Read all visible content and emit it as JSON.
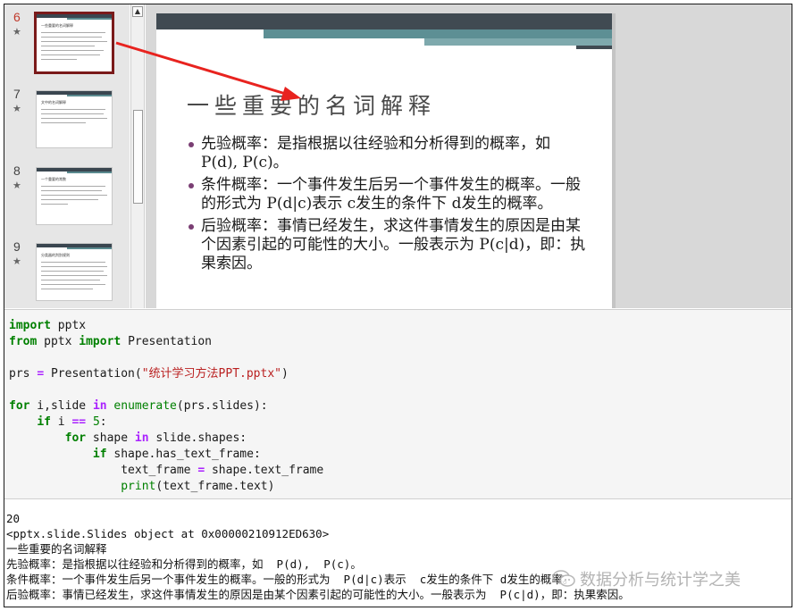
{
  "thumbnails": [
    {
      "number": "6",
      "star": "★",
      "title": "一些重要的名词解释",
      "active": true
    },
    {
      "number": "7",
      "star": "★",
      "title": "文中的名词解释",
      "active": false
    },
    {
      "number": "8",
      "star": "★",
      "title": "一个重要的常数",
      "active": false
    },
    {
      "number": "9",
      "star": "★",
      "title": "分类器的判别规则",
      "active": false
    }
  ],
  "scroll_up_glyph": "▲",
  "slide": {
    "title": "一些重要的名词解释",
    "bullets": [
      "先验概率：是指根据以往经验和分析得到的概率，如 P(d), P(c)。",
      "条件概率：一个事件发生后另一个事件发生的概率。一般的形式为 P(d|c)表示 c发生的条件下 d发生的概率。",
      "后验概率：事情已经发生，求这件事情发生的原因是由某个因素引起的可能性的大小。一般表示为 P(c|d)，即：执果索因。"
    ],
    "bullet_color": "#7a3e73"
  },
  "arrow_color": "#e8231f",
  "code": {
    "line1": {
      "kw": "import",
      "rest": " pptx"
    },
    "line2": {
      "kw1": "from",
      "mid": " pptx ",
      "kw2": "import",
      "rest": " Presentation"
    },
    "line3": {
      "pre": "prs ",
      "op": "=",
      "mid": " Presentation(",
      "str": "\"统计学习方法PPT.pptx\"",
      "post": ")"
    },
    "line4": {
      "kw1": "for",
      "mid": " i,slide ",
      "kw2": "in",
      "sp": " ",
      "bi": "enumerate",
      "post": "(prs.slides):"
    },
    "line5": {
      "indent": "    ",
      "kw": "if",
      "mid": " i ",
      "op": "==",
      "sp": " ",
      "num": "5",
      "post": ":"
    },
    "line6": {
      "indent": "        ",
      "kw1": "for",
      "mid": " shape ",
      "kw2": "in",
      "post": " slide.shapes:"
    },
    "line7": {
      "indent": "            ",
      "kw": "if",
      "post": " shape.has_text_frame:"
    },
    "line8": {
      "indent": "                ",
      "pre": "text_frame ",
      "op": "=",
      "post": " shape.text_frame"
    },
    "line9": {
      "indent": "                ",
      "bi": "print",
      "post": "(text_frame.text)"
    }
  },
  "output": {
    "lines": [
      "20",
      "<pptx.slide.Slides object at 0x00000210912ED630>",
      "一些重要的名词解释",
      "先验概率：是指根据以往经验和分析得到的概率，如  P(d),  P(c)。",
      "条件概率：一个事件发生后另一个事件发生的概率。一般的形式为  P(d|c)表示  c发生的条件下 d发生的概率。",
      "后验概率：事情已经发生，求这件事情发生的原因是由某个因素引起的可能性的大小。一般表示为  P(c|d)，即：执果索因。"
    ]
  },
  "watermark": {
    "text": "数据分析与统计学之美",
    "icon": "wechat-icon"
  }
}
